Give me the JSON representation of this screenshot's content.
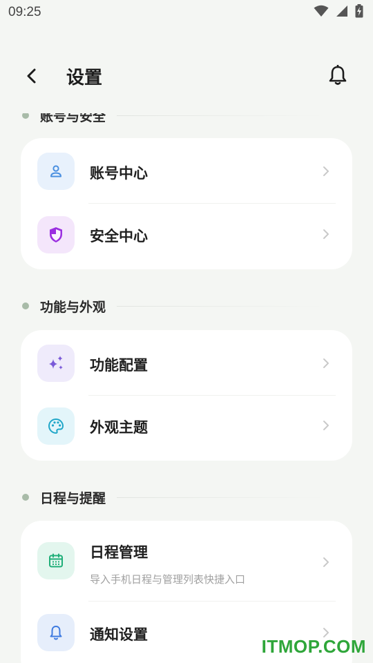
{
  "status_bar": {
    "time": "09:25"
  },
  "header": {
    "title": "设置"
  },
  "sections": [
    {
      "title": "账号与安全",
      "items": [
        {
          "title": "账号中心",
          "icon": "user-icon",
          "icon_color": "#4a8fe0",
          "bg": "#e8f1fc"
        },
        {
          "title": "安全中心",
          "icon": "shield-icon",
          "icon_color": "#9b2fe0",
          "bg": "#f4e6fb"
        }
      ]
    },
    {
      "title": "功能与外观",
      "items": [
        {
          "title": "功能配置",
          "icon": "sparkle-icon",
          "icon_color": "#7a5ad8",
          "bg": "#efebfb"
        },
        {
          "title": "外观主题",
          "icon": "palette-icon",
          "icon_color": "#1fa6c8",
          "bg": "#e3f5fa"
        }
      ]
    },
    {
      "title": "日程与提醒",
      "items": [
        {
          "title": "日程管理",
          "subtitle": "导入手机日程与管理列表快捷入口",
          "icon": "calendar-icon",
          "icon_color": "#1fae78",
          "bg": "#e3f6ee"
        },
        {
          "title": "通知设置",
          "icon": "bell-icon",
          "icon_color": "#3f7be0",
          "bg": "#e6eefb"
        }
      ]
    }
  ],
  "watermark": "ITMOP.COM"
}
